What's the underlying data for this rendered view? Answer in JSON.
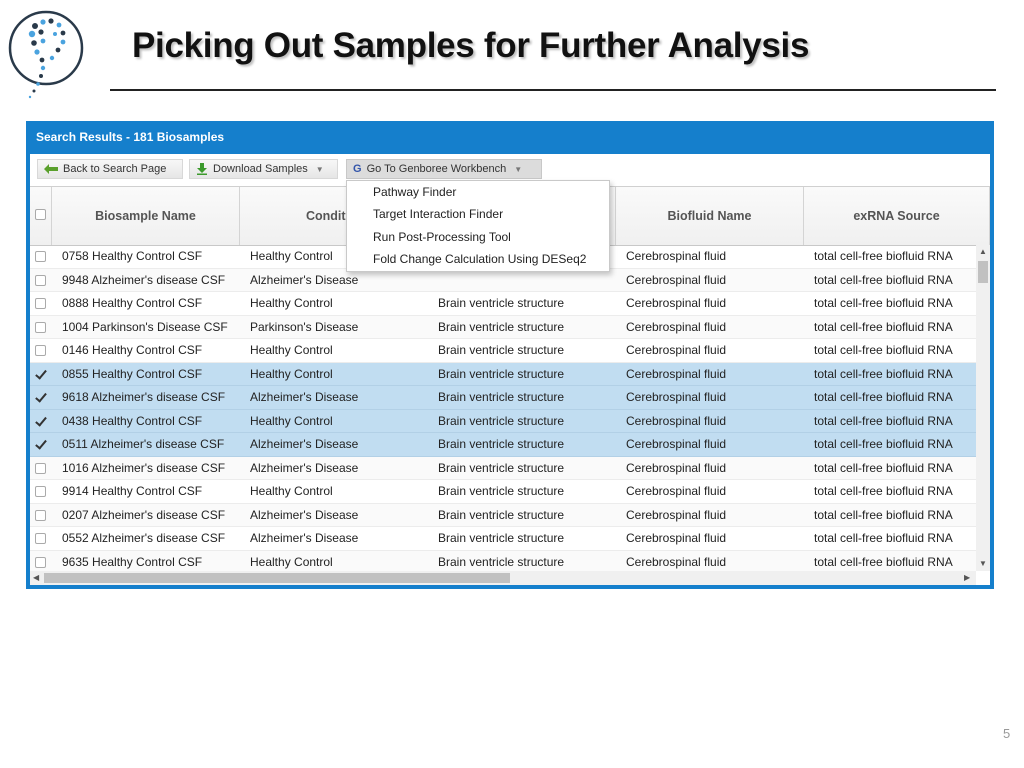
{
  "slide": {
    "title": "Picking Out Samples for Further Analysis",
    "page_number": "5"
  },
  "panel": {
    "title": "Search Results - 181 Biosamples"
  },
  "toolbar": {
    "back_label": "Back to Search Page",
    "download_label": "Download Samples",
    "workbench_label": "Go To Genboree Workbench",
    "workbench_icon_letter": "G"
  },
  "menu": {
    "items": [
      "Pathway Finder",
      "Target Interaction Finder",
      "Run Post-Processing Tool",
      "Fold Change Calculation Using DESeq2"
    ]
  },
  "columns": [
    "Biosample Name",
    "Conditi",
    "",
    "Biofluid Name",
    "exRNA Source"
  ],
  "rows": [
    {
      "name": "0758 Healthy Control CSF",
      "condition": "Healthy Control",
      "anatomy": "",
      "biofluid": "Cerebrospinal fluid",
      "source": "total cell-free biofluid RNA",
      "selected": false
    },
    {
      "name": "9948 Alzheimer's disease CSF",
      "condition": "Alzheimer's Disease",
      "anatomy": "",
      "biofluid": "Cerebrospinal fluid",
      "source": "total cell-free biofluid RNA",
      "selected": false
    },
    {
      "name": "0888 Healthy Control CSF",
      "condition": "Healthy Control",
      "anatomy": "Brain ventricle structure",
      "biofluid": "Cerebrospinal fluid",
      "source": "total cell-free biofluid RNA",
      "selected": false
    },
    {
      "name": "1004 Parkinson's Disease CSF",
      "condition": "Parkinson's Disease",
      "anatomy": "Brain ventricle structure",
      "biofluid": "Cerebrospinal fluid",
      "source": "total cell-free biofluid RNA",
      "selected": false
    },
    {
      "name": "0146 Healthy Control CSF",
      "condition": "Healthy Control",
      "anatomy": "Brain ventricle structure",
      "biofluid": "Cerebrospinal fluid",
      "source": "total cell-free biofluid RNA",
      "selected": false
    },
    {
      "name": "0855 Healthy Control CSF",
      "condition": "Healthy Control",
      "anatomy": "Brain ventricle structure",
      "biofluid": "Cerebrospinal fluid",
      "source": "total cell-free biofluid RNA",
      "selected": true
    },
    {
      "name": "9618 Alzheimer's disease CSF",
      "condition": "Alzheimer's Disease",
      "anatomy": "Brain ventricle structure",
      "biofluid": "Cerebrospinal fluid",
      "source": "total cell-free biofluid RNA",
      "selected": true
    },
    {
      "name": "0438 Healthy Control CSF",
      "condition": "Healthy Control",
      "anatomy": "Brain ventricle structure",
      "biofluid": "Cerebrospinal fluid",
      "source": "total cell-free biofluid RNA",
      "selected": true
    },
    {
      "name": "0511 Alzheimer's disease CSF",
      "condition": "Alzheimer's Disease",
      "anatomy": "Brain ventricle structure",
      "biofluid": "Cerebrospinal fluid",
      "source": "total cell-free biofluid RNA",
      "selected": true
    },
    {
      "name": "1016 Alzheimer's disease CSF",
      "condition": "Alzheimer's Disease",
      "anatomy": "Brain ventricle structure",
      "biofluid": "Cerebrospinal fluid",
      "source": "total cell-free biofluid RNA",
      "selected": false
    },
    {
      "name": "9914 Healthy Control CSF",
      "condition": "Healthy Control",
      "anatomy": "Brain ventricle structure",
      "biofluid": "Cerebrospinal fluid",
      "source": "total cell-free biofluid RNA",
      "selected": false
    },
    {
      "name": "0207 Alzheimer's disease CSF",
      "condition": "Alzheimer's Disease",
      "anatomy": "Brain ventricle structure",
      "biofluid": "Cerebrospinal fluid",
      "source": "total cell-free biofluid RNA",
      "selected": false
    },
    {
      "name": "0552 Alzheimer's disease CSF",
      "condition": "Alzheimer's Disease",
      "anatomy": "Brain ventricle structure",
      "biofluid": "Cerebrospinal fluid",
      "source": "total cell-free biofluid RNA",
      "selected": false
    },
    {
      "name": "9635 Healthy Control CSF",
      "condition": "Healthy Control",
      "anatomy": "Brain ventricle structure",
      "biofluid": "Cerebrospinal fluid",
      "source": "total cell-free biofluid RNA",
      "selected": false
    }
  ],
  "icons": {
    "back": "arrow-left-icon",
    "download": "download-arrow-icon",
    "dropdown": "caret-down-icon"
  },
  "colors": {
    "panel_header": "#157fcc",
    "selected_row": "#c1ddf1",
    "logo_dark": "#2a3a4a",
    "logo_blue": "#4aa3df"
  }
}
